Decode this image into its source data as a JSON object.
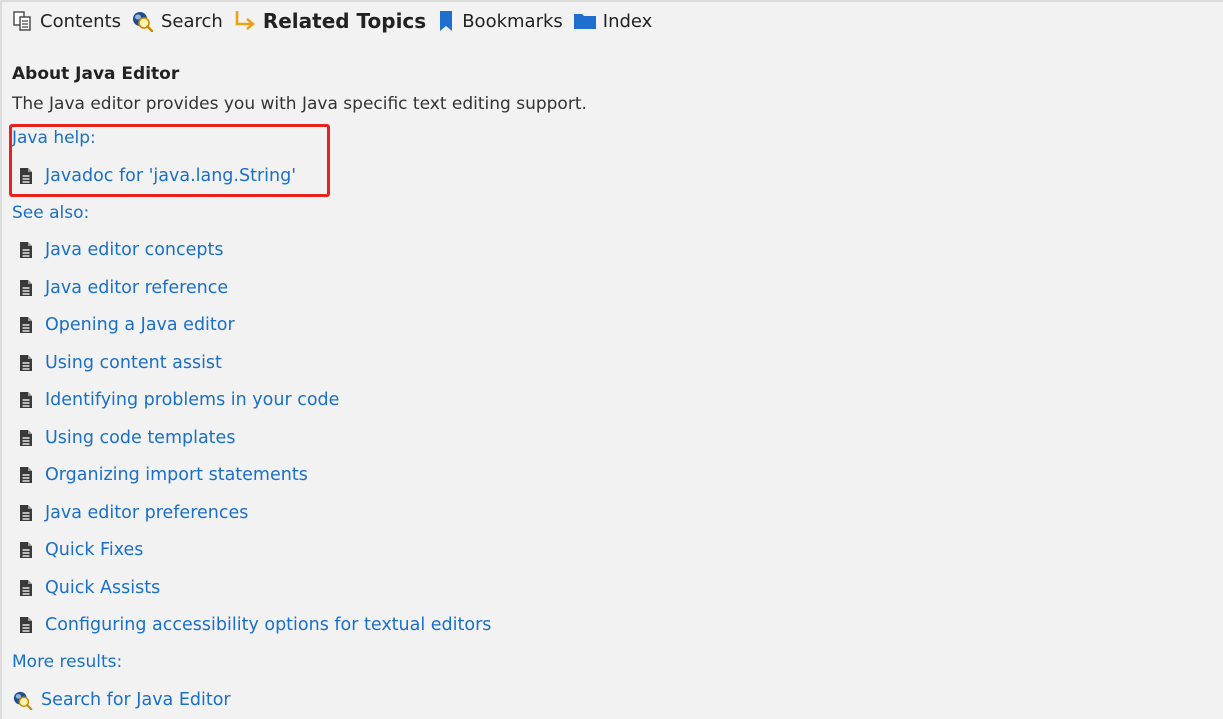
{
  "tabs": [
    {
      "name": "tab-contents",
      "label": "Contents",
      "icon": "contents-icon"
    },
    {
      "name": "tab-search",
      "label": "Search",
      "icon": "search-icon"
    },
    {
      "name": "tab-related-topics",
      "label": "Related Topics",
      "icon": "related-topics-arrow-icon",
      "active": true
    },
    {
      "name": "tab-bookmarks",
      "label": "Bookmarks",
      "icon": "bookmark-icon"
    },
    {
      "name": "tab-index",
      "label": "Index",
      "icon": "folder-icon"
    }
  ],
  "about": {
    "title": "About Java Editor",
    "description": "The Java editor provides you with Java specific text editing support."
  },
  "java_help": {
    "label": "Java help:",
    "items": [
      "Javadoc for 'java.lang.String'"
    ]
  },
  "see_also": {
    "label": "See also:",
    "items": [
      "Java editor concepts",
      "Java editor reference",
      "Opening a Java editor",
      "Using content assist",
      "Identifying problems in your code",
      "Using code templates",
      "Organizing import statements",
      "Java editor preferences",
      "Quick Fixes",
      "Quick Assists",
      "Configuring accessibility options for textual editors"
    ]
  },
  "more_results": {
    "label": "More results:",
    "search_link": "Search for Java Editor"
  },
  "colors": {
    "link": "#1a6fc9",
    "highlight": "#e8231c",
    "background": "#f2f2f2",
    "related_arrow": "#e8a317",
    "bookmark": "#1f6fd1"
  }
}
